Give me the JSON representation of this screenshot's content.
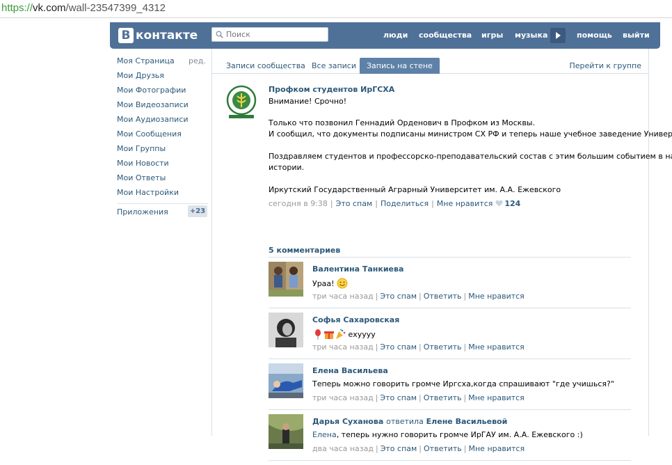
{
  "browser": {
    "url_scheme": "https://",
    "url_host": "vk.com",
    "url_path": "/wall-23547399_4312"
  },
  "header": {
    "logo_letter": "В",
    "logo_text": "контакте",
    "search_placeholder": "Поиск",
    "nav": [
      "люди",
      "сообщества",
      "игры",
      "музыка",
      "помощь",
      "выйти"
    ]
  },
  "sidebar": {
    "edit_label": "ред.",
    "items": [
      "Моя Страница",
      "Мои Друзья",
      "Мои Фотографии",
      "Мои Видеозаписи",
      "Мои Аудиозаписи",
      "Мои Сообщения",
      "Мои Группы",
      "Мои Новости",
      "Мои Ответы",
      "Мои Настройки"
    ],
    "apps_label": "Приложения",
    "apps_badge": "+23"
  },
  "tabs": {
    "items": [
      "Записи сообщества",
      "Все записи",
      "Запись на стене"
    ],
    "active_index": 2,
    "goto_group": "Перейти к группе"
  },
  "post": {
    "author": "Профком студентов ИрГСХА",
    "lines": [
      "Внимание! Срочно!",
      "Только что позвонил Геннадий Орденович в Профком из Москвы.",
      "И сообщил, что документы подписаны министром СХ РФ и теперь наше учебное заведение Университет!!!",
      "Поздравляем студентов и профессорско-преподавательский состав с этим большим событием в нашей",
      "истории.",
      "Иркутский Государственный Аграрный Университет им. А.А. Ежевского"
    ],
    "time": "сегодня в 9:38",
    "spam": "Это спам",
    "share": "Поделиться",
    "like": "Мне нравится",
    "likes_count": "124"
  },
  "comments_header": "5 комментариев",
  "comments": [
    {
      "name": "Валентина Танкиева",
      "reply_to": "",
      "text": "Ураа!",
      "addressee": "",
      "time": "три часа назад",
      "spam": "Это спам",
      "reply": "Ответить",
      "like": "Мне нравится"
    },
    {
      "name": "Софья Сахаровская",
      "reply_to": "",
      "text": "ехуууу",
      "addressee": "",
      "time": "три часа назад",
      "spam": "Это спам",
      "reply": "Ответить",
      "like": "Мне нравится"
    },
    {
      "name": "Елена Васильева",
      "reply_to": "",
      "text": "Теперь можно говорить громче Иргсха,когда спрашивают \"где учишься?\"",
      "addressee": "",
      "time": "три часа назад",
      "spam": "Это спам",
      "reply": "Ответить",
      "like": "Мне нравится"
    },
    {
      "name": "Дарья Суханова",
      "reply_word": "ответила",
      "reply_to": "Елене Васильевой",
      "text": ", теперь нужно говорить громче ИрГАУ им. А.А. Ежевского :)",
      "addressee": "Елена",
      "time": "два часа назад",
      "spam": "Это спам",
      "reply": "Ответить",
      "like": "Мне нравится"
    }
  ],
  "colors": {
    "header_bg": "#4f7198",
    "link": "#2b587a",
    "active_tab": "#5e81a8",
    "meta_gray": "#999999"
  }
}
